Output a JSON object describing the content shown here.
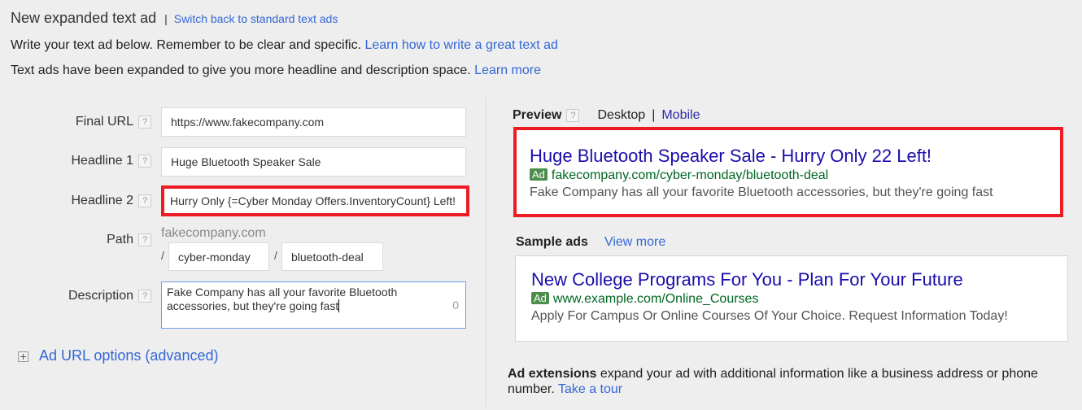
{
  "header": {
    "title": "New expanded text ad",
    "separator": "|",
    "switch_link": "Switch back to standard text ads",
    "intro_text": "Write your text ad below. Remember to be clear and specific.",
    "intro_link": "Learn how to write a great text ad",
    "expanded_text": "Text ads have been expanded to give you more headline and description space.",
    "expanded_link": "Learn more"
  },
  "form": {
    "help_glyph": "?",
    "final_url": {
      "label": "Final URL",
      "value": "https://www.fakecompany.com"
    },
    "headline1": {
      "label": "Headline 1",
      "value": "Huge Bluetooth Speaker Sale"
    },
    "headline2": {
      "label": "Headline 2",
      "value": "Hurry Only {=Cyber Monday Offers.InventoryCount} Left!",
      "highlighted": true
    },
    "path": {
      "label": "Path",
      "domain": "fakecompany.com",
      "slash": "/",
      "path1": "cyber-monday",
      "path2": "bluetooth-deal"
    },
    "description": {
      "label": "Description",
      "value": "Fake Company has all your favorite Bluetooth accessories, but they're going fast",
      "chars_remaining": "0"
    },
    "advanced_link": "Ad URL options (advanced)",
    "advanced_icon": "plus-box-icon"
  },
  "preview": {
    "label": "Preview",
    "tabs": [
      {
        "label": "Desktop",
        "active": true
      },
      {
        "label": "Mobile",
        "active": false
      }
    ],
    "tab_separator": "|",
    "ad": {
      "title": "Huge Bluetooth Speaker Sale - Hurry Only 22 Left!",
      "badge": "Ad",
      "display_url": "fakecompany.com/cyber-monday/bluetooth-deal",
      "description": "Fake Company has all your favorite Bluetooth accessories, but they're going fast"
    }
  },
  "sample_ads": {
    "label": "Sample ads",
    "view_more": "View more",
    "ad": {
      "title": "New College Programs For You - Plan For Your Future",
      "badge": "Ad",
      "display_url": "www.example.com/Online_Courses",
      "description": "Apply For Campus Or Online Courses Of Your Choice. Request Information Today!"
    }
  },
  "extensions": {
    "bold": "Ad extensions",
    "text": "expand your ad with additional information like a business address or phone number.",
    "link": "Take a tour"
  },
  "colors": {
    "highlight_red": "#ed1c24",
    "link_blue": "#3367d6",
    "ad_title": "#1a0dab",
    "ad_url": "#006621",
    "badge_green": "#4c8d4c"
  }
}
